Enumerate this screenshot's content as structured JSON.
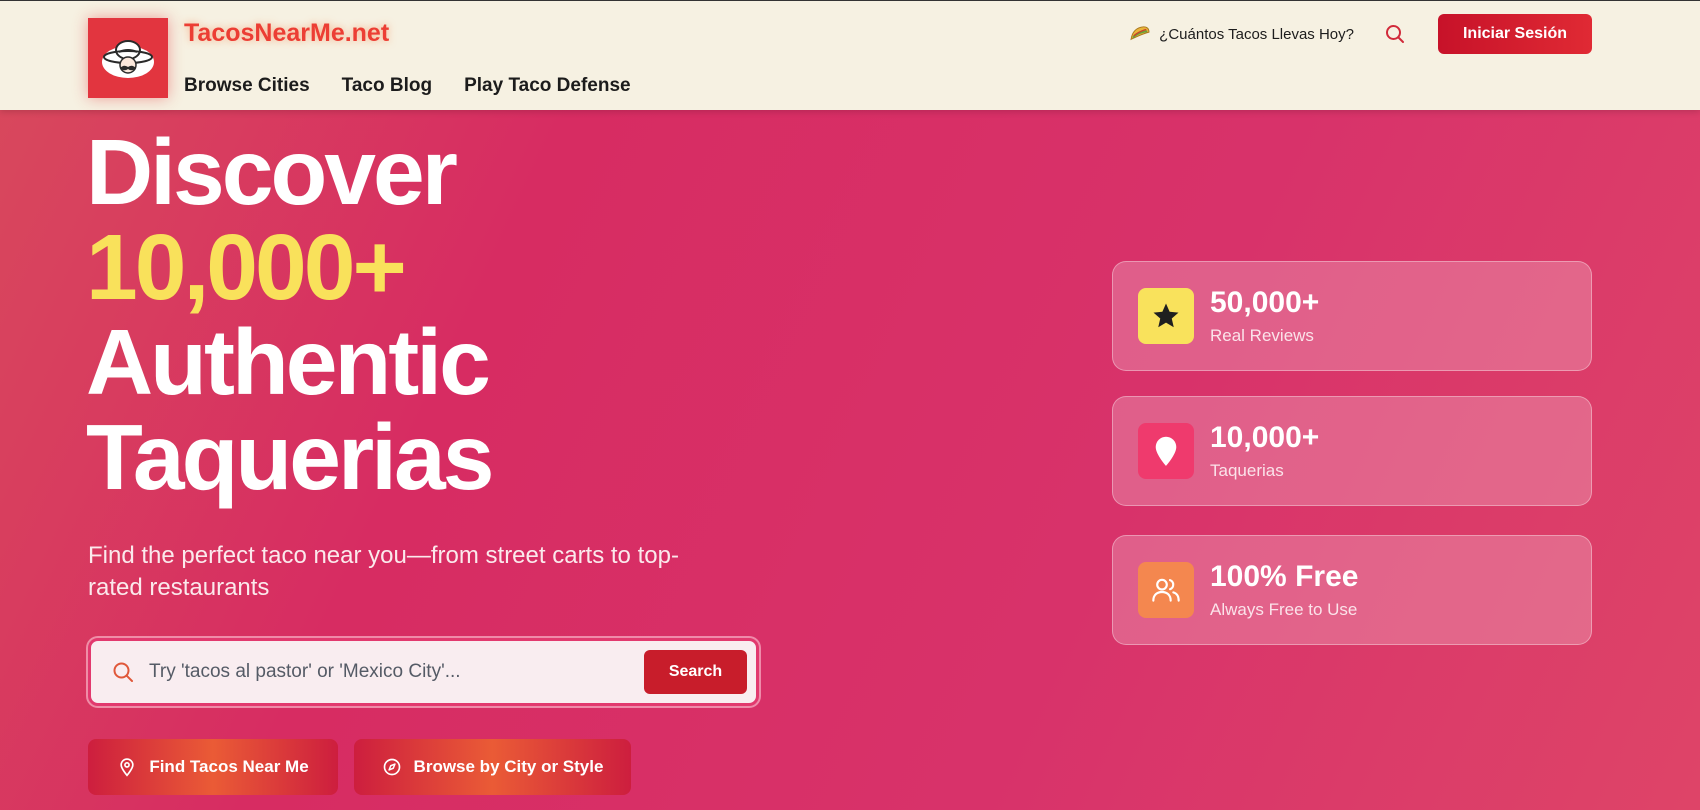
{
  "header": {
    "brand": "TacosNearMe.net",
    "nav": [
      "Browse Cities",
      "Taco Blog",
      "Play Taco Defense"
    ],
    "promo_text": "¿Cuántos Tacos Llevas Hoy?",
    "login_label": "Iniciar Sesión"
  },
  "hero": {
    "title_line1": "Discover",
    "title_accent": "10,000+",
    "title_line3": "Authentic",
    "title_line4": "Taquerias",
    "subtitle": "Find the perfect taco near you—from street carts to top-rated restaurants"
  },
  "search": {
    "placeholder": "Try 'tacos al pastor' or 'Mexico City'...",
    "button_label": "Search"
  },
  "cta": {
    "find_label": "Find Tacos Near Me",
    "browse_label": "Browse by City or Style"
  },
  "stats": [
    {
      "value": "50,000+",
      "label": "Real Reviews",
      "icon": "star-icon"
    },
    {
      "value": "10,000+",
      "label": "Taquerias",
      "icon": "map-pin-icon"
    },
    {
      "value": "100% Free",
      "label": "Always Free to Use",
      "icon": "users-icon"
    }
  ],
  "colors": {
    "accent_red": "#c81d2b",
    "accent_yellow": "#f9e15b",
    "header_bg": "#f6f1e2",
    "hero_pink": "#d72c62"
  }
}
